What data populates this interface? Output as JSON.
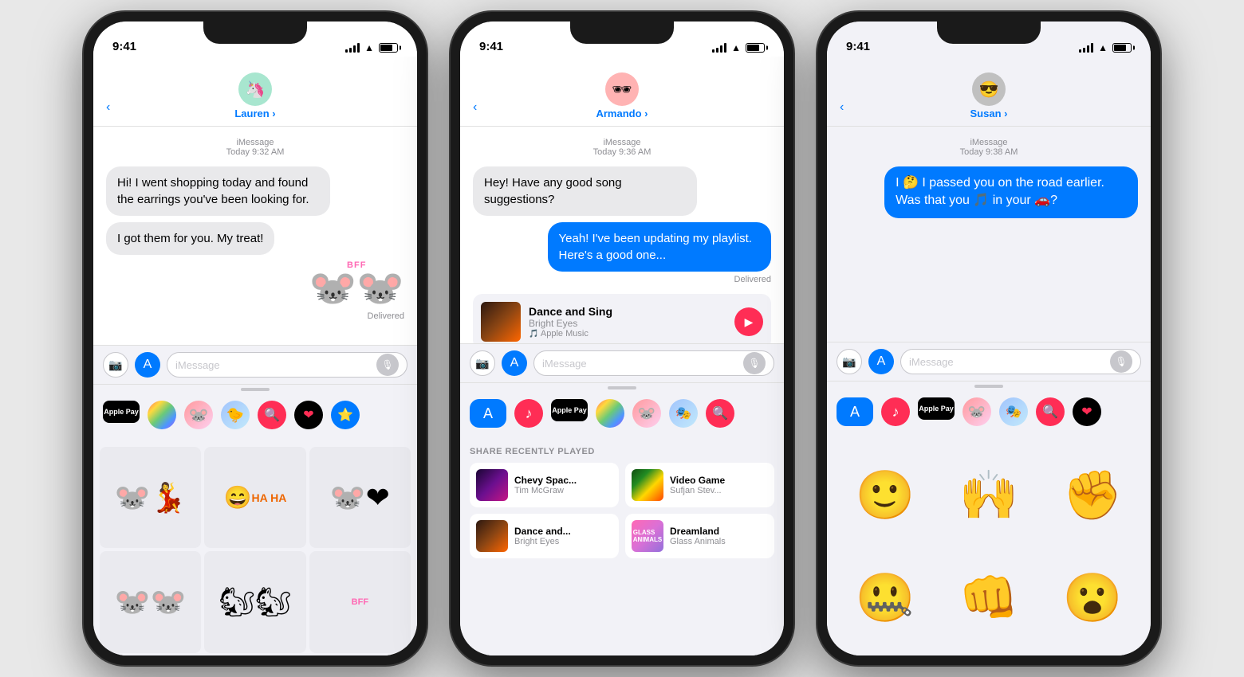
{
  "phones": [
    {
      "id": "phone-lauren",
      "time": "9:41",
      "contact": {
        "name": "Lauren",
        "avatar_emoji": "🦄",
        "avatar_bg": "#a8e6cf"
      },
      "imessage_label": "iMessage",
      "date_label": "Today 9:32 AM",
      "messages": [
        {
          "type": "received",
          "text": "Hi! I went shopping today and found the earrings you've been looking for."
        },
        {
          "type": "received",
          "text": "I got them for you. My treat!"
        }
      ],
      "delivered_label": "Delivered",
      "input_placeholder": "iMessage",
      "drawer_items": [
        "Apple Pay",
        "",
        "",
        "",
        "",
        "",
        ""
      ],
      "stickers": [
        "mickey-minnie",
        "donald-ha",
        "minnie-heart",
        "mickey-minnie-2",
        "chip-dale",
        "bff-text"
      ]
    },
    {
      "id": "phone-armando",
      "time": "9:41",
      "contact": {
        "name": "Armando",
        "avatar_emoji": "🕶",
        "avatar_bg": "#ffb3b3"
      },
      "imessage_label": "iMessage",
      "date_label": "Today 9:36 AM",
      "messages": [
        {
          "type": "received",
          "text": "Hey! Have any good song suggestions?"
        },
        {
          "type": "sent",
          "text": "Yeah! I've been updating my playlist. Here's a good one..."
        }
      ],
      "delivered_label": "Delivered",
      "music_card": {
        "title": "Dance and Sing",
        "artist": "Bright Eyes",
        "source": "Apple Music"
      },
      "input_placeholder": "iMessage",
      "share_recently_label": "SHARE RECENTLY PLAYED",
      "recently_played": [
        {
          "title": "Chevy Spac...",
          "artist": "Tim McGraw",
          "album_class": "album-chevy"
        },
        {
          "title": "Video Game",
          "artist": "Sufjan Stev...",
          "album_class": "album-video-game"
        },
        {
          "title": "Dance and...",
          "artist": "Bright Eyes",
          "album_class": "album-dance-grid"
        },
        {
          "title": "Dreamland",
          "artist": "Glass Animals",
          "album_class": "album-dreamland"
        }
      ]
    },
    {
      "id": "phone-susan",
      "time": "9:41",
      "contact": {
        "name": "Susan",
        "avatar_emoji": "😎",
        "avatar_bg": "#c0c0c0"
      },
      "imessage_label": "iMessage",
      "date_label": "Today 9:38 AM",
      "messages": [
        {
          "type": "sent",
          "text": "I 🤔 I passed you on the road earlier. Was that you 🎵 in your 🚗?"
        }
      ],
      "input_placeholder": "iMessage",
      "memoji_items": [
        "😄",
        "🙌",
        "🤛",
        "🤐",
        "🤜",
        "😮"
      ]
    }
  ],
  "back_chevron": "‹",
  "chevron_right": "›",
  "music_source_label": "Apple Music"
}
